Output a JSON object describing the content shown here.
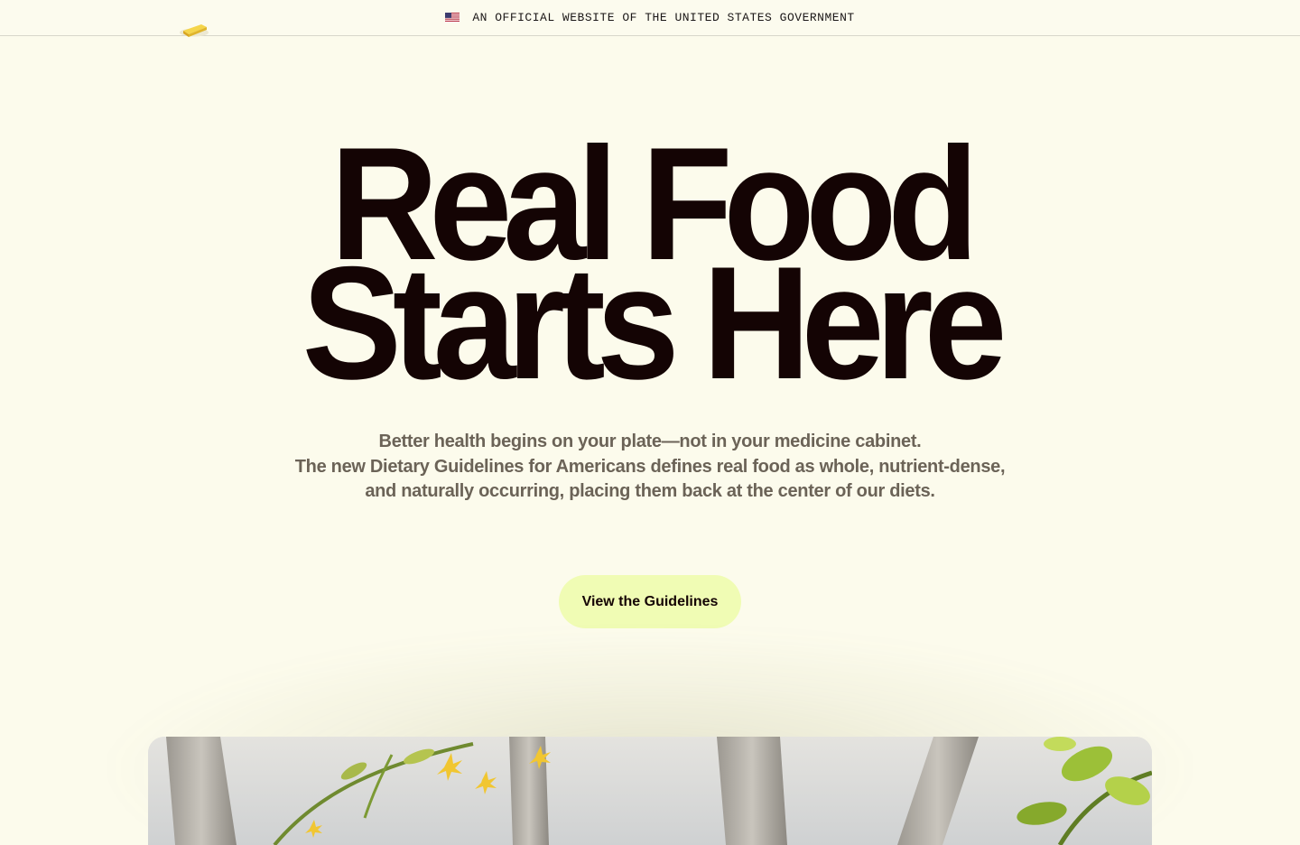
{
  "gov_banner": {
    "text": "AN OFFICIAL WEBSITE OF THE UNITED STATES GOVERNMENT",
    "flag_icon": "us-flag-icon"
  },
  "logo": {
    "icon": "butter-icon"
  },
  "hero": {
    "headline_line1": "Real Food",
    "headline_line2": "Starts Here",
    "subtitle_line1": "Better health begins on your plate—not in your medicine cabinet.",
    "subtitle_line2": "The new Dietary Guidelines for Americans defines real food as whole, nutrient-dense, and naturally occurring, placing them back at the center of our diets.",
    "cta_label": "View the Guidelines"
  },
  "colors": {
    "background": "#fcfbec",
    "headline": "#140404",
    "subtitle": "#6b6357",
    "cta_background": "#f0fcb4"
  }
}
